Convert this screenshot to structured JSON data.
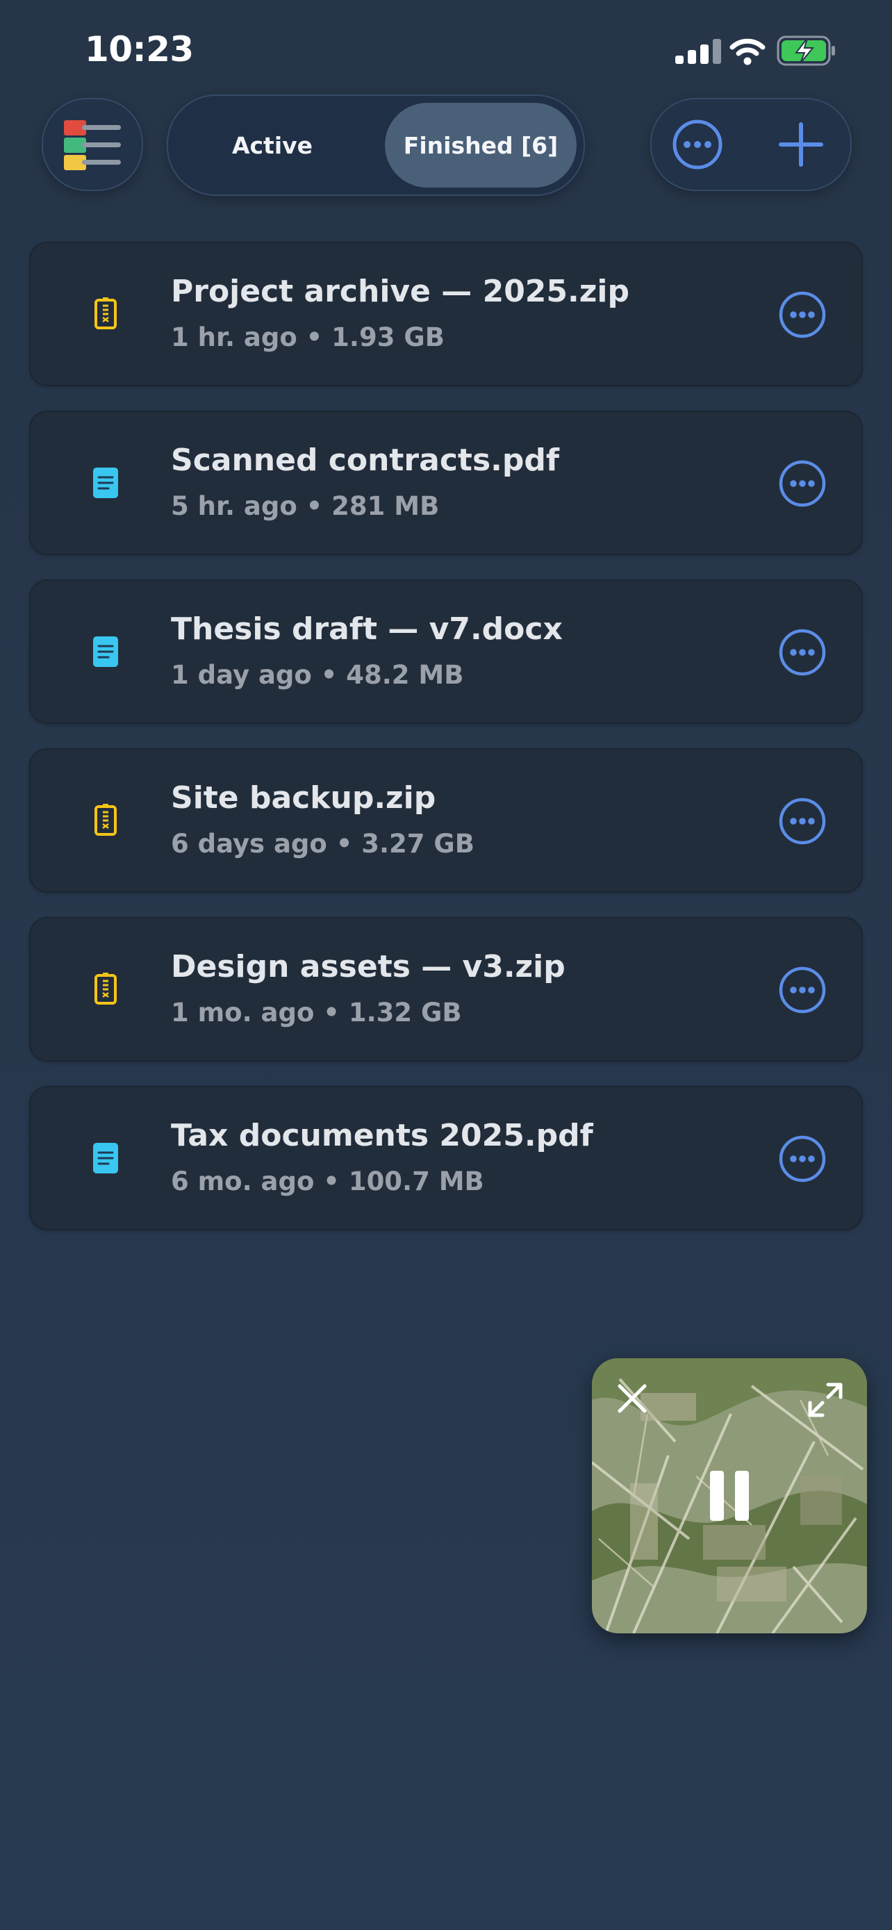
{
  "status_bar": {
    "time": "10:23",
    "battery_icon": "battery-charging-icon",
    "wifi_icon": "wifi-icon",
    "signal_icon": "cellular-signal-icon"
  },
  "toolbar": {
    "menu_icon": "color-list-menu-icon",
    "segments": {
      "active_label": "Active",
      "finished_label": "Finished [6]",
      "selected": "finished"
    },
    "more_icon": "more-circle-icon",
    "add_icon": "plus-icon"
  },
  "downloads": [
    {
      "title": "Project archive — 2025.zip",
      "meta": "1 hr. ago • 1.93 GB",
      "type": "zip",
      "icon": "zip-file-icon"
    },
    {
      "title": "Scanned contracts.pdf",
      "meta": "5 hr. ago • 281 MB",
      "type": "doc",
      "icon": "document-icon"
    },
    {
      "title": "Thesis draft — v7.docx",
      "meta": "1 day ago • 48.2 MB",
      "type": "doc",
      "icon": "document-icon"
    },
    {
      "title": "Site backup.zip",
      "meta": "6 days ago • 3.27 GB",
      "type": "zip",
      "icon": "zip-file-icon"
    },
    {
      "title": "Design assets — v3.zip",
      "meta": "1 mo. ago • 1.32 GB",
      "type": "zip",
      "icon": "zip-file-icon"
    },
    {
      "title": "Tax documents 2025.pdf",
      "meta": "6 mo. ago • 100.7 MB",
      "type": "doc",
      "icon": "document-icon"
    }
  ],
  "pip_player": {
    "state": "playing",
    "progress": 0.05,
    "close_icon": "close-icon",
    "expand_icon": "expand-icon",
    "pause_icon": "pause-icon"
  },
  "colors": {
    "accent": "#5b8de8",
    "zip": "#f5c518",
    "doc": "#39c6f0",
    "background": "#27374c"
  }
}
